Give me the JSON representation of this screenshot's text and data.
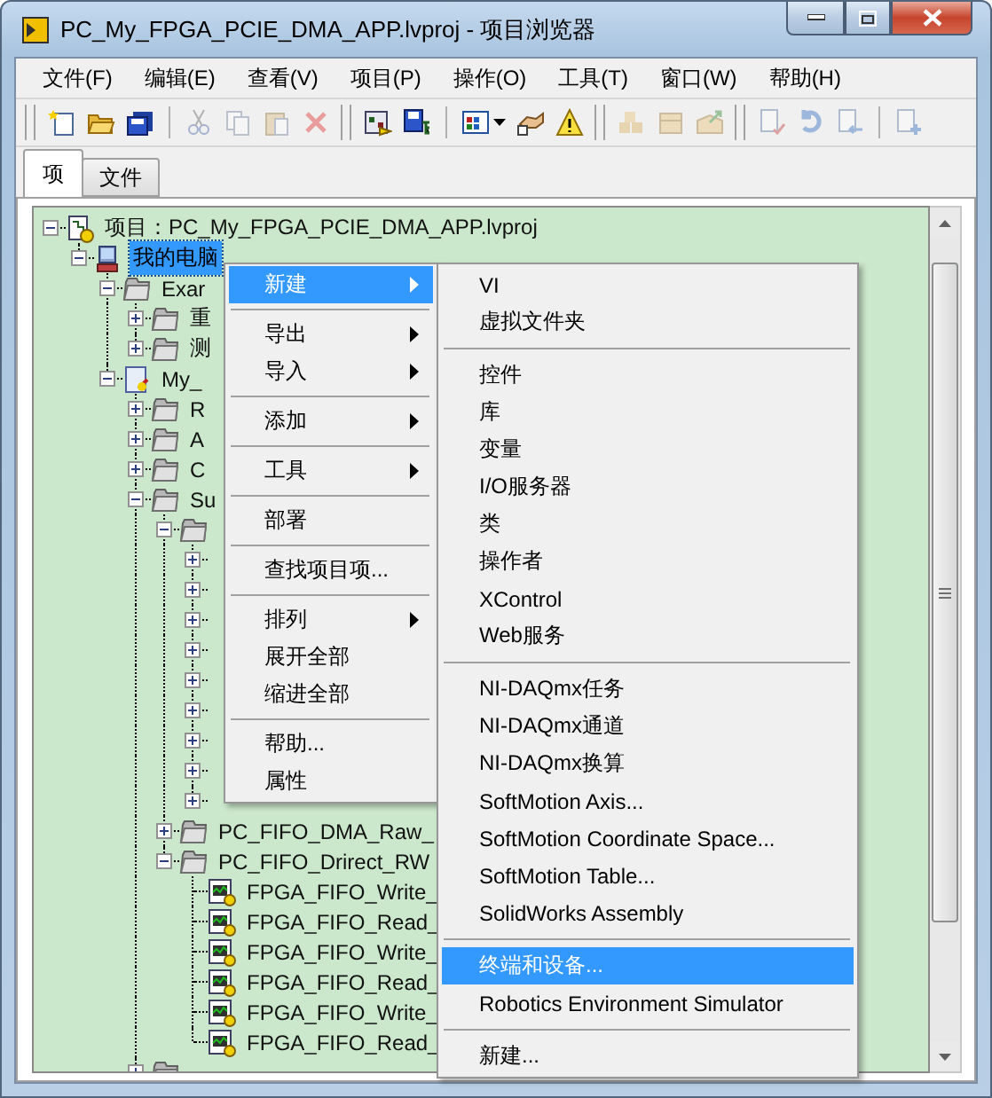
{
  "window": {
    "title": "PC_My_FPGA_PCIE_DMA_APP.lvproj - 项目浏览器"
  },
  "menubar": [
    "文件(F)",
    "编辑(E)",
    "查看(V)",
    "项目(P)",
    "操作(O)",
    "工具(T)",
    "窗口(W)",
    "帮助(H)"
  ],
  "toolbar": [
    {
      "groups": [
        {
          "buttons": [
            {
              "disabled": false
            },
            {
              "disabled": false
            },
            {
              "disabled": false
            }
          ]
        },
        {
          "buttons": [
            {
              "disabled": true
            },
            {
              "disabled": true
            },
            {
              "disabled": true
            },
            {
              "disabled": true
            }
          ]
        }
      ]
    },
    {
      "groups": [
        {
          "buttons": [
            {
              "disabled": false
            },
            {
              "disabled": false
            }
          ]
        },
        {
          "buttons": [
            {
              "disabled": false
            },
            {
              "disabled": false
            },
            {
              "disabled": false
            }
          ]
        }
      ]
    },
    {
      "groups": [
        {
          "buttons": [
            {
              "disabled": true
            },
            {
              "disabled": true
            },
            {
              "disabled": true
            }
          ]
        }
      ]
    },
    {
      "groups": [
        {
          "buttons": [
            {
              "disabled": true
            },
            {
              "disabled": true
            },
            {
              "disabled": true
            }
          ]
        },
        {
          "buttons": [
            {
              "disabled": true
            }
          ]
        }
      ]
    }
  ],
  "tabs": [
    {
      "label": "项",
      "selected": true
    },
    {
      "label": "文件",
      "selected": false
    }
  ],
  "tree": [
    {
      "label": "项目：PC_My_FPGA_PCIE_DMA_APP.lvproj",
      "kind": "project",
      "expanded": true,
      "selected": false,
      "children": [
        {
          "label": "我的电脑",
          "kind": "computer",
          "expanded": true,
          "selected": true,
          "children": [
            {
              "label": "Exar",
              "kind": "folder",
              "expanded": true,
              "selected": false,
              "children": [
                {
                  "label": "重",
                  "kind": "folder",
                  "expanded": false,
                  "selected": false
                },
                {
                  "label": "测",
                  "kind": "folder",
                  "expanded": false,
                  "selected": false
                }
              ]
            },
            {
              "label": "My_",
              "kind": "library",
              "expanded": true,
              "selected": false,
              "children": [
                {
                  "label": "R",
                  "kind": "folder",
                  "expanded": false,
                  "selected": false
                },
                {
                  "label": "A",
                  "kind": "folder",
                  "expanded": false,
                  "selected": false
                },
                {
                  "label": "C",
                  "kind": "folder",
                  "expanded": false,
                  "selected": false
                },
                {
                  "label": "Su",
                  "kind": "folder",
                  "expanded": true,
                  "selected": false,
                  "children": [
                    {
                      "kind": "folder",
                      "expanded": true,
                      "children": [
                        {
                          "expanded": false
                        },
                        {
                          "expanded": false
                        },
                        {
                          "expanded": false
                        },
                        {
                          "expanded": false
                        },
                        {
                          "expanded": false
                        },
                        {
                          "expanded": false
                        },
                        {
                          "expanded": false
                        },
                        {
                          "expanded": false
                        },
                        {
                          "expanded": false
                        }
                      ]
                    },
                    {
                      "label": "PC_FIFO_DMA_Raw_",
                      "kind": "folder",
                      "expanded": false,
                      "selected": false
                    },
                    {
                      "label": "PC_FIFO_Drirect_RW",
                      "kind": "folder",
                      "expanded": true,
                      "selected": false,
                      "children": [
                        {
                          "label": "FPGA_FIFO_Write_",
                          "kind": "vi",
                          "selected": false
                        },
                        {
                          "label": "FPGA_FIFO_Read_",
                          "kind": "vi",
                          "selected": false
                        },
                        {
                          "label": "FPGA_FIFO_Write_",
                          "kind": "vi",
                          "selected": false
                        },
                        {
                          "label": "FPGA_FIFO_Read_",
                          "kind": "vi",
                          "selected": false
                        },
                        {
                          "label": "FPGA_FIFO_Write_",
                          "kind": "vi",
                          "selected": false
                        },
                        {
                          "label": "FPGA_FIFO_Read_",
                          "kind": "vi",
                          "selected": false
                        }
                      ]
                    }
                  ]
                },
                {
                  "kind": "folder",
                  "expanded": false
                }
              ]
            }
          ]
        }
      ]
    }
  ],
  "context_menu": [
    {
      "kind": "item",
      "label": "新建",
      "submenu": true,
      "selected": true
    },
    {
      "kind": "separator"
    },
    {
      "kind": "item",
      "label": "导出",
      "submenu": true,
      "selected": false
    },
    {
      "kind": "item",
      "label": "导入",
      "submenu": true,
      "selected": false
    },
    {
      "kind": "separator"
    },
    {
      "kind": "item",
      "label": "添加",
      "submenu": true,
      "selected": false
    },
    {
      "kind": "separator"
    },
    {
      "kind": "item",
      "label": "工具",
      "submenu": true,
      "selected": false
    },
    {
      "kind": "separator"
    },
    {
      "kind": "item",
      "label": "部署",
      "submenu": false,
      "selected": false
    },
    {
      "kind": "separator"
    },
    {
      "kind": "item",
      "label": "查找项目项...",
      "submenu": false,
      "selected": false
    },
    {
      "kind": "separator"
    },
    {
      "kind": "item",
      "label": "排列",
      "submenu": true,
      "selected": false
    },
    {
      "kind": "item",
      "label": "展开全部",
      "submenu": false,
      "selected": false
    },
    {
      "kind": "item",
      "label": "缩进全部",
      "submenu": false,
      "selected": false
    },
    {
      "kind": "separator"
    },
    {
      "kind": "item",
      "label": "帮助...",
      "submenu": false,
      "selected": false
    },
    {
      "kind": "item",
      "label": "属性",
      "submenu": false,
      "selected": false
    }
  ],
  "submenu": [
    {
      "kind": "item",
      "label": "VI",
      "selected": false
    },
    {
      "kind": "item",
      "label": "虚拟文件夹",
      "selected": false
    },
    {
      "kind": "separator"
    },
    {
      "kind": "item",
      "label": "控件",
      "selected": false
    },
    {
      "kind": "item",
      "label": "库",
      "selected": false
    },
    {
      "kind": "item",
      "label": "变量",
      "selected": false
    },
    {
      "kind": "item",
      "label": "I/O服务器",
      "selected": false
    },
    {
      "kind": "item",
      "label": "类",
      "selected": false
    },
    {
      "kind": "item",
      "label": "操作者",
      "selected": false
    },
    {
      "kind": "item",
      "label": "XControl",
      "selected": false
    },
    {
      "kind": "item",
      "label": "Web服务",
      "selected": false
    },
    {
      "kind": "separator"
    },
    {
      "kind": "item",
      "label": "NI-DAQmx任务",
      "selected": false
    },
    {
      "kind": "item",
      "label": "NI-DAQmx通道",
      "selected": false
    },
    {
      "kind": "item",
      "label": "NI-DAQmx换算",
      "selected": false
    },
    {
      "kind": "item",
      "label": "SoftMotion Axis...",
      "selected": false
    },
    {
      "kind": "item",
      "label": "SoftMotion Coordinate Space...",
      "selected": false
    },
    {
      "kind": "item",
      "label": "SoftMotion Table...",
      "selected": false
    },
    {
      "kind": "item",
      "label": "SolidWorks Assembly",
      "selected": false
    },
    {
      "kind": "separator"
    },
    {
      "kind": "item",
      "label": "终端和设备...",
      "selected": true
    },
    {
      "kind": "item",
      "label": "Robotics Environment Simulator",
      "selected": false
    },
    {
      "kind": "separator"
    },
    {
      "kind": "item",
      "label": "新建...",
      "selected": false
    }
  ]
}
